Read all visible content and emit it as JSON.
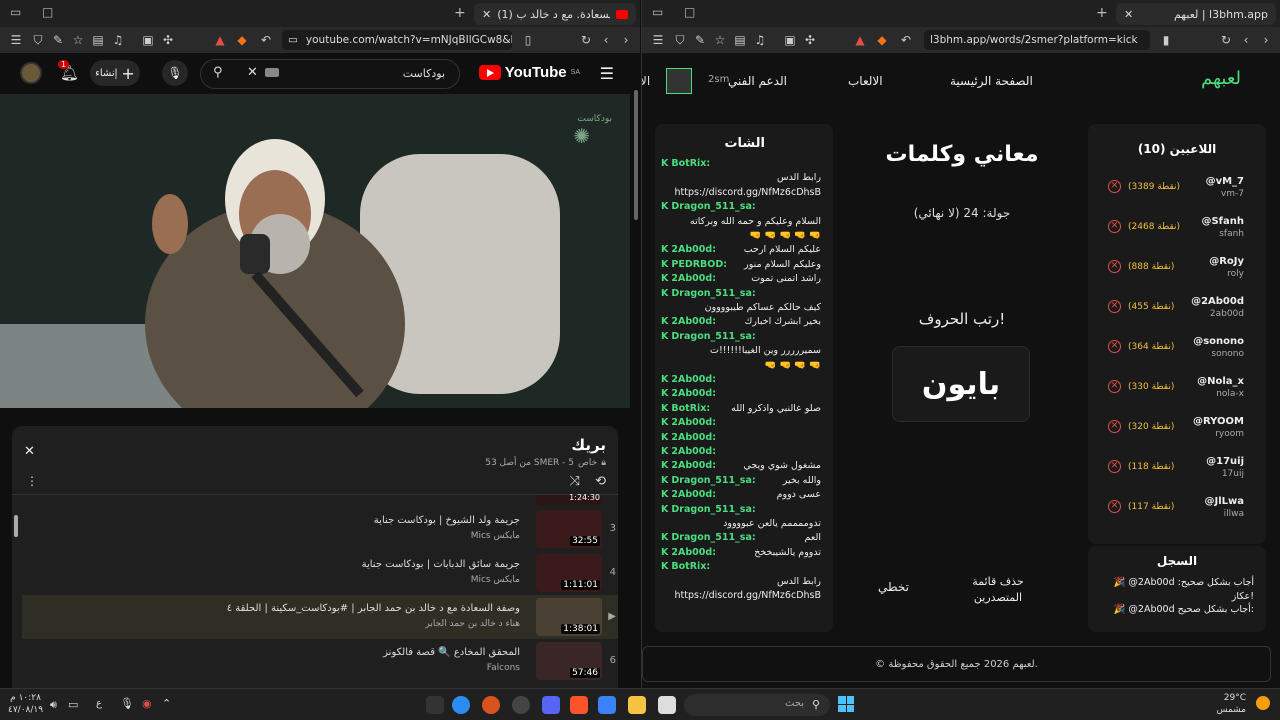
{
  "left_browser": {
    "tab_title": "(1) وصفة السعادة. مع د خالد ب",
    "url": "youtube.com/watch?v=mNJqBIlGCw8&list",
    "yt": {
      "search_value": "بودكاست",
      "create_label": "إنشاء",
      "logo_text": "YouTube",
      "logo_region": "SA",
      "notif_count": "1",
      "channel_corner": "بودكاست"
    },
    "playlist": {
      "title": "بريك",
      "meta": "SMER - 5 من أصل 53",
      "privacy": "خاص",
      "items": [
        {
          "num": "3",
          "title": "جريمة ولد الشيوخ | بودكاست جناية",
          "channel": "Mics مايكس",
          "duration": "32:55"
        },
        {
          "num": "4",
          "title": "جريمة سائق الدبابات | بودكاست جناية",
          "channel": "Mics مايكس",
          "duration": "1:11:01"
        },
        {
          "num": "",
          "title": "وصفة السعادة مع د خالد بن حمد الجابر | #بودكاست_سكينة | الحلقة ٤",
          "channel": "هناء د خالد بن حمد الجابر",
          "duration": "1:38:01",
          "active": true
        },
        {
          "num": "6",
          "title": "المحقق المخادع 🔍 قصة فالكونز",
          "channel": "Falcons",
          "duration": "57:46"
        }
      ],
      "partial_duration": "1:24:30"
    }
  },
  "right_browser": {
    "tab_title": "لعبهم | l3bhm.app",
    "url": "l3bhm.app/words/2smer?platform=kick",
    "site": {
      "logo": "لعبهم",
      "nav": [
        "الصفحة الرئيسية",
        "الالعاب",
        "الدعم الفني",
        "2sm",
        "الا"
      ],
      "players_title": "اللاعبين (10)",
      "players": [
        {
          "name": "@vM_7",
          "user": "vm-7",
          "points": "(3389 نقطة)"
        },
        {
          "name": "@Sfanh",
          "user": "sfanh",
          "points": "(2468 نقطة)"
        },
        {
          "name": "@RoJy",
          "user": "roly",
          "points": "(888 نقطة)"
        },
        {
          "name": "@2Ab00d",
          "user": "2ab00d",
          "points": "(455 نقطة)"
        },
        {
          "name": "@sonono",
          "user": "sonono",
          "points": "(364 نقطة)"
        },
        {
          "name": "@Nola_x",
          "user": "nola-x",
          "points": "(330 نقطة)"
        },
        {
          "name": "@RYOOM",
          "user": "ryoom",
          "points": "(320 نقطة)"
        },
        {
          "name": "@17uij",
          "user": "17uij",
          "points": "(118 نقطة)"
        },
        {
          "name": "@JlLwa",
          "user": "illwa",
          "points": "(117 نقطة)"
        }
      ],
      "game_title": "معاني وكلمات",
      "round": "جولة: 24 (لا نهائي)",
      "instruction": "رتب الحروف!",
      "scrambled": "بايون",
      "skip": "تخطي",
      "clear_leaders": "حذف قائمة المتصدرين",
      "log_title": "السجل",
      "log": [
        "🎉 @2Ab00d أجاب بشكل صحيح: عكاز!",
        "🎉 @2Ab00d أجاب بشكل صحيح:"
      ],
      "chat_title": "الشات",
      "chat": [
        {
          "who": "BotRix:",
          "text": ""
        },
        {
          "who": "",
          "text": "رابط الدس"
        },
        {
          "who": "",
          "text": "https://discord.gg/NfMz6cDhsB"
        },
        {
          "who": "Dragon_511_sa:",
          "text": ""
        },
        {
          "who": "",
          "text": "السلام وعليكم و حمه الله وبركاته"
        },
        {
          "who": "",
          "text": "🤜 🤜 🤜 🤜 🤜"
        },
        {
          "who": "2Ab00d:",
          "text": "عليكم السلام ارحب"
        },
        {
          "who": "PEDRBOD:",
          "text": "وعليكم السلام منور"
        },
        {
          "who": "2Ab00d:",
          "text": "راشد اتمنى تموت"
        },
        {
          "who": "Dragon_511_sa:",
          "text": ""
        },
        {
          "who": "",
          "text": "كيف حالكم عساكم طيبوووون"
        },
        {
          "who": "2Ab00d:",
          "text": "بخير ابشرك اخبارك"
        },
        {
          "who": "Dragon_511_sa:",
          "text": ""
        },
        {
          "who": "",
          "text": "سميررررر وين الغيبا!!!!!!ت"
        },
        {
          "who": "",
          "text": "🤜 🤜 🤜 🤜"
        },
        {
          "who": "2Ab00d:",
          "text": ""
        },
        {
          "who": "2Ab00d:",
          "text": ""
        },
        {
          "who": "BotRix:",
          "text": "صلو عالنبي واذكرو الله"
        },
        {
          "who": "2Ab00d:",
          "text": ""
        },
        {
          "who": "2Ab00d:",
          "text": ""
        },
        {
          "who": "2Ab00d:",
          "text": ""
        },
        {
          "who": "2Ab00d:",
          "text": "مشغول شوي ويجي"
        },
        {
          "who": "Dragon_511_sa:",
          "text": "والله بخير"
        },
        {
          "who": "2Ab00d:",
          "text": "عسى دووم"
        },
        {
          "who": "Dragon_511_sa:",
          "text": ""
        },
        {
          "who": "",
          "text": "تدوممممم يالعن عبوووود"
        },
        {
          "who": "Dragon_511_sa:",
          "text": "العم"
        },
        {
          "who": "2Ab00d:",
          "text": "تدووم يالشيبخخخ"
        },
        {
          "who": "BotRix:",
          "text": ""
        },
        {
          "who": "",
          "text": "رابط الدس"
        },
        {
          "who": "",
          "text": "https://discord.gg/NfMz6cDhsB"
        }
      ],
      "footer": "© لعبهم 2026 جميع الحقوق محفوظة."
    }
  },
  "taskbar": {
    "time": "١٠:٢٨ م",
    "date": "٤٧/٠٨/١٩",
    "search_placeholder": "بحث",
    "weather_temp": "29°C",
    "weather_desc": "مشمس",
    "lang": "ع"
  },
  "colors": {
    "kick_green": "#4ade80",
    "yt_red": "#ff0000",
    "points": "#f0c040",
    "remove": "#e0504a"
  }
}
